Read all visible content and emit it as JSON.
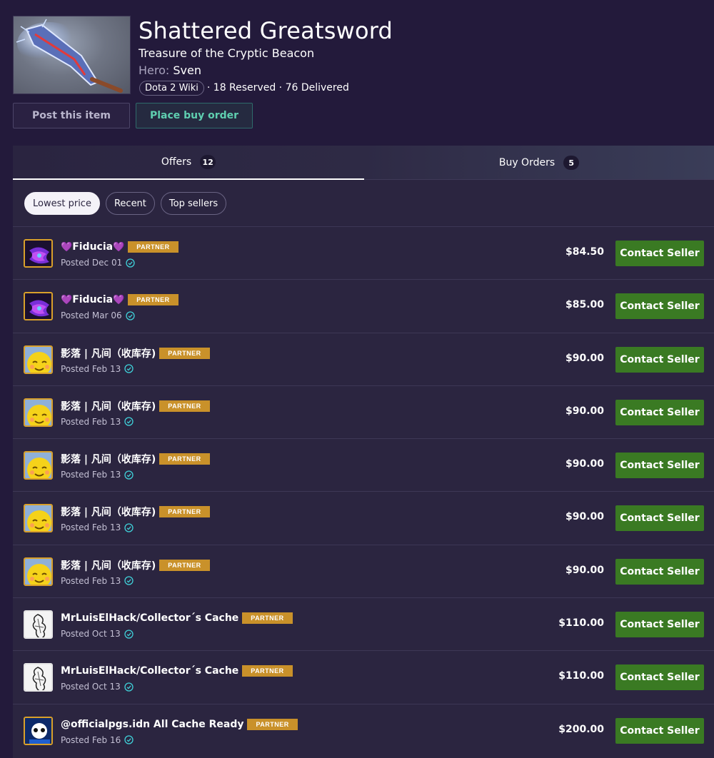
{
  "item": {
    "title": "Shattered Greatsword",
    "subtitle": "Treasure of the Cryptic Beacon",
    "hero_label": "Hero:",
    "hero_name": "Sven",
    "wiki_label": "Dota 2 Wiki",
    "stats_text": "· 18 Reserved · 76 Delivered",
    "image_icon": "greatsword-image"
  },
  "actions": {
    "post_label": "Post this item",
    "buy_order_label": "Place buy order"
  },
  "tabs": [
    {
      "label": "Offers",
      "count": "12",
      "active": true
    },
    {
      "label": "Buy Orders",
      "count": "5",
      "active": false
    }
  ],
  "filters": [
    {
      "label": "Lowest price",
      "active": true
    },
    {
      "label": "Recent",
      "active": false
    },
    {
      "label": "Top sellers",
      "active": false
    }
  ],
  "partner_label": "PARTNER",
  "contact_label": "Contact Seller",
  "colors": {
    "background": "#231a3b",
    "panel": "#2b2540",
    "partner_badge": "#c9912a",
    "contact_button": "#3a7a23",
    "buy_order_text": "#5fcfb0",
    "verified": "#3fd0d8"
  },
  "offers": [
    {
      "name": "Fiducia",
      "hearts": true,
      "posted": "Posted Dec 01",
      "price": "$84.50",
      "avatar": "purple-avatar"
    },
    {
      "name": "Fiducia",
      "hearts": true,
      "posted": "Posted Mar 06",
      "price": "$85.00",
      "avatar": "purple-avatar"
    },
    {
      "name": "影落 | 凡间（收库存)",
      "hearts": false,
      "posted": "Posted Feb 13",
      "price": "$90.00",
      "avatar": "yellow-avatar"
    },
    {
      "name": "影落 | 凡间（收库存)",
      "hearts": false,
      "posted": "Posted Feb 13",
      "price": "$90.00",
      "avatar": "yellow-avatar"
    },
    {
      "name": "影落 | 凡间（收库存)",
      "hearts": false,
      "posted": "Posted Feb 13",
      "price": "$90.00",
      "avatar": "yellow-avatar"
    },
    {
      "name": "影落 | 凡间（收库存)",
      "hearts": false,
      "posted": "Posted Feb 13",
      "price": "$90.00",
      "avatar": "yellow-avatar"
    },
    {
      "name": "影落 | 凡间（收库存)",
      "hearts": false,
      "posted": "Posted Feb 13",
      "price": "$90.00",
      "avatar": "yellow-avatar"
    },
    {
      "name": "MrLuisElHack/Collector´s Cache",
      "hearts": false,
      "posted": "Posted Oct 13",
      "price": "$110.00",
      "avatar": "sketch-avatar"
    },
    {
      "name": "MrLuisElHack/Collector´s Cache",
      "hearts": false,
      "posted": "Posted Oct 13",
      "price": "$110.00",
      "avatar": "sketch-avatar"
    },
    {
      "name": "@officialpgs.idn All Cache Ready",
      "hearts": false,
      "posted": "Posted Feb 16",
      "price": "$200.00",
      "avatar": "blue-avatar"
    }
  ]
}
